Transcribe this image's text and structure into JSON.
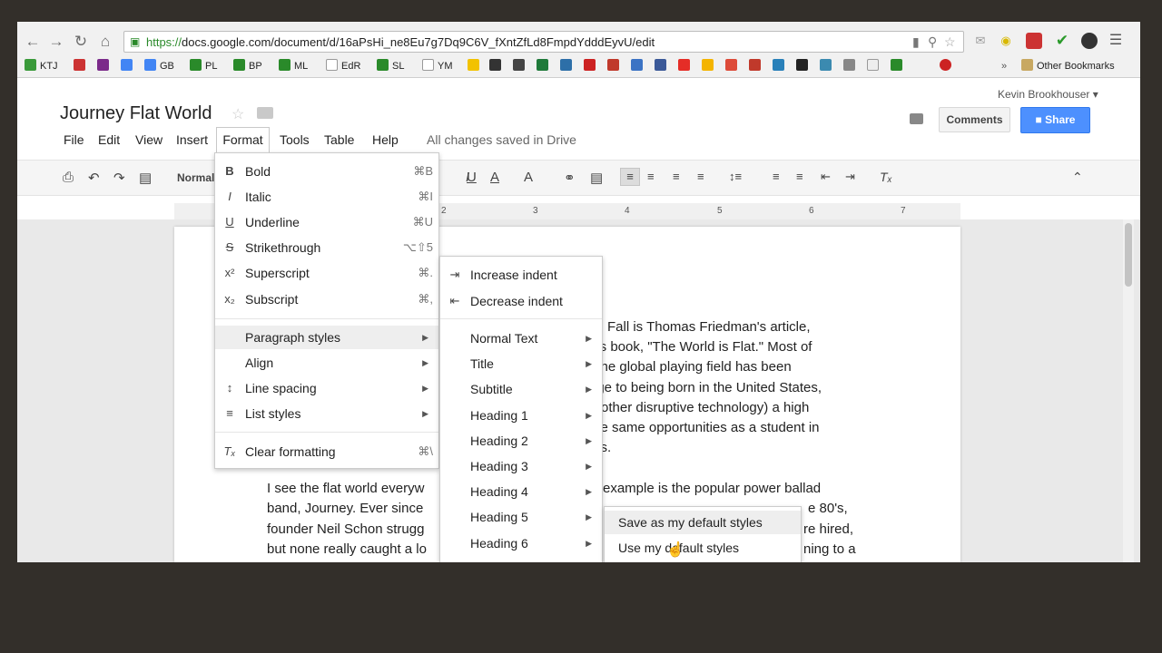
{
  "browser": {
    "url_secure": "https://",
    "url_rest": "docs.google.com/document/d/16aPsHi_ne8Eu7g7Dq9C6V_fXntZfLd8FmpdYdddEyvU/edit",
    "bookmarks": [
      {
        "label": "KTJ",
        "color": "#3a9a3a"
      },
      {
        "label": "",
        "color": "#cc3333"
      },
      {
        "label": "",
        "color": "#7b2a8a"
      },
      {
        "label": "",
        "color": "#4285f4"
      },
      {
        "label": "GB",
        "color": "#4285f4"
      },
      {
        "label": "PL",
        "color": "#2a8a2a"
      },
      {
        "label": "BP",
        "color": "#2a8a2a"
      },
      {
        "label": "ML",
        "color": "#2a8a2a"
      },
      {
        "label": "EdR",
        "color": "#999999"
      },
      {
        "label": "SL",
        "color": "#2a8a2a"
      },
      {
        "label": "YM",
        "color": "#888888"
      }
    ],
    "other_bookmarks": "Other Bookmarks"
  },
  "doc": {
    "title": "Journey Flat World",
    "user": "Kevin Brookhouser",
    "comments_label": "Comments",
    "share_label": "Share",
    "saved_status": "All changes saved in Drive"
  },
  "menubar": [
    "File",
    "Edit",
    "View",
    "Insert",
    "Format",
    "Tools",
    "Table",
    "Help"
  ],
  "toolbar": {
    "style_label": "Normal"
  },
  "ruler": [
    "2",
    "3",
    "4",
    "5",
    "6",
    "7"
  ],
  "format_menu": {
    "items": [
      {
        "icon": "B",
        "label": "Bold",
        "shortcut": "⌘B"
      },
      {
        "icon": "I",
        "label": "Italic",
        "shortcut": "⌘I"
      },
      {
        "icon": "U",
        "label": "Underline",
        "shortcut": "⌘U"
      },
      {
        "icon": "S",
        "label": "Strikethrough",
        "shortcut": "⌥⇧5"
      },
      {
        "icon": "x²",
        "label": "Superscript",
        "shortcut": "⌘."
      },
      {
        "icon": "x₂",
        "label": "Subscript",
        "shortcut": "⌘,"
      }
    ],
    "paragraph_styles": "Paragraph styles",
    "align": "Align",
    "line_spacing": "Line spacing",
    "list_styles": "List styles",
    "clear_formatting": "Clear formatting",
    "clear_shortcut": "⌘\\"
  },
  "paragraph_menu": {
    "increase_indent": "Increase indent",
    "decrease_indent": "Decrease indent",
    "styles": [
      "Normal Text",
      "Title",
      "Subtitle",
      "Heading 1",
      "Heading 2",
      "Heading 3",
      "Heading 4",
      "Heading 5",
      "Heading 6"
    ]
  },
  "options_menu": {
    "save_default": "Save as my default styles",
    "use_default": "Use my default styles"
  },
  "document_text": {
    "right_lines": [
      "ch Fall is Thomas Friedman's article,",
      "his book, \"The World is Flat.\" Most of",
      ", the global playing field has been",
      "age to being born in the United States,",
      "other disruptive technology) a high",
      "the same opportunities as a student in",
      "nts."
    ],
    "lower_left": [
      "I see the flat world everyw",
      "band, Journey. Ever since",
      "founder Neil Schon strugg",
      "but none really caught a lo"
    ],
    "lower_right": [
      "example is the popular power ballad",
      "e 80's,",
      "re hired,",
      "ning to a"
    ]
  }
}
